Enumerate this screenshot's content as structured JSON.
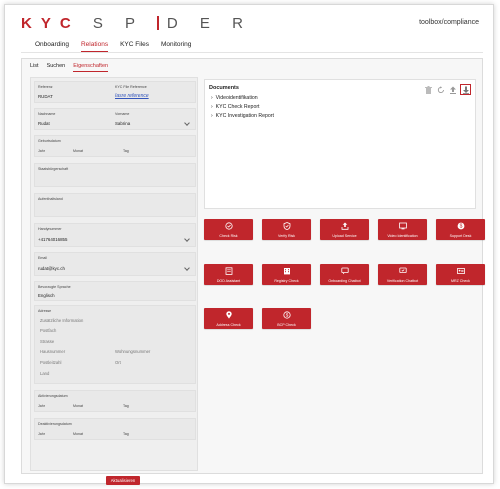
{
  "brand": {
    "kyc": "KYC",
    "spider": "SPIDER"
  },
  "tenant": "toolbox/compliance",
  "main_tabs": [
    "Onboarding",
    "Relations",
    "KYC Files",
    "Monitoring"
  ],
  "sub_tabs": [
    "List",
    "Suchen",
    "Eigenschaften"
  ],
  "form": {
    "reference": {
      "label": "Referenz",
      "value": "RUDAT"
    },
    "kyc_file_reference": {
      "label": "KYC File Reference",
      "link": "Iasre reference"
    },
    "lastname": {
      "label": "Nachname",
      "value": "Rudat"
    },
    "firstname": {
      "label": "Vorname",
      "value": "Sabrina"
    },
    "birthdate": {
      "label": "Geburtsdatum",
      "year": "Jahr",
      "month": "Monat",
      "day": "Tag"
    },
    "citizenship": {
      "label": "Staatsbürgerschaft"
    },
    "residence": {
      "label": "Aufenthaltsland"
    },
    "mobile": {
      "label": "Handynummer",
      "value": "+41764016855"
    },
    "email": {
      "label": "Email",
      "value": "rudat@kyc.ch"
    },
    "language": {
      "label": "Bevorzugte Sprache",
      "value": "Englisch"
    },
    "address": {
      "label": "Adresse",
      "additional": "Zusätzliche Information",
      "postbox": "Postfach",
      "street": "Strasse",
      "house_number": "Hausnummer",
      "apartment_number": "Wohnungsnummer",
      "postcode": "Postleitzahl",
      "city": "Ort",
      "country": "Land"
    },
    "activation_date": {
      "label": "Aktivierungsdatum",
      "year": "Jahr",
      "month": "Monat",
      "day": "Tag"
    },
    "deactivation_date": {
      "label": "Deaktivierungsdatum",
      "year": "Jahr",
      "month": "Monat",
      "day": "Tag"
    },
    "update_button": "Aktualisieren"
  },
  "documents": {
    "title": "Documents",
    "items": [
      "Videoidentifikation",
      "KYC Check Report",
      "KYC Investigation Report"
    ]
  },
  "actions": [
    {
      "label": "Check Risk",
      "icon": "lock-icon"
    },
    {
      "label": "Verify Risk",
      "icon": "shield-check-icon"
    },
    {
      "label": "Upload Service",
      "icon": "upload-icon"
    },
    {
      "label": "Video Identification",
      "icon": "video-icon"
    },
    {
      "label": "Support Desk",
      "icon": "dollar-icon"
    },
    {
      "label": "DOD Assistant",
      "icon": "document-icon"
    },
    {
      "label": "Registry Check",
      "icon": "building-icon"
    },
    {
      "label": "Onboarding Chatbot",
      "icon": "chat-icon"
    },
    {
      "label": "Verification Chatbot",
      "icon": "chat-check-icon"
    },
    {
      "label": "MRZ Check",
      "icon": "id-card-icon"
    },
    {
      "label": "Address Check",
      "icon": "map-pin-icon"
    },
    {
      "label": "BCP Check",
      "icon": "dollar-circle-icon"
    }
  ],
  "colors": {
    "accent": "#c0262c",
    "panel": "#f7f7f7",
    "field": "#e9e9e9"
  }
}
